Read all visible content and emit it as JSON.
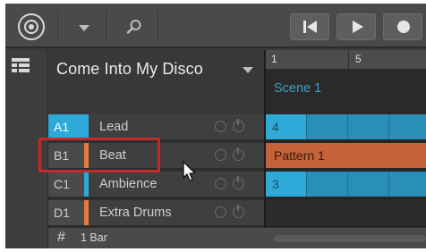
{
  "toolbar": {
    "icons": [
      "logo-icon",
      "chevron-down-icon",
      "search-icon",
      "skip-back-icon",
      "play-icon",
      "record-icon"
    ]
  },
  "project": {
    "title": "Come Into My Disco"
  },
  "sounds": [
    {
      "slot": "A1",
      "name": "Lead",
      "color": "#2fa9d8"
    },
    {
      "slot": "B1",
      "name": "Beat",
      "color": "#e87a3c"
    },
    {
      "slot": "C1",
      "name": "Ambience",
      "color": "#2fa9d8"
    },
    {
      "slot": "D1",
      "name": "Extra Drums",
      "color": "#e87a3c"
    }
  ],
  "arranger": {
    "ruler_marks": [
      "1",
      "5"
    ],
    "scene": "Scene 1",
    "lane_a": "4",
    "pattern": "Pattern 1",
    "lane_c": "3"
  },
  "grid": {
    "hash": "#",
    "value": "1 Bar"
  },
  "colors": {
    "accent_blue": "#2fa9d8",
    "accent_orange": "#e87a3c",
    "highlight_red": "#c42a2a"
  }
}
